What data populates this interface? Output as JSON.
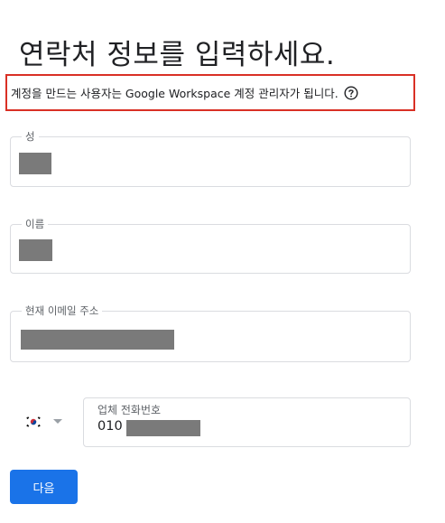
{
  "page": {
    "title": "연락처 정보를 입력하세요."
  },
  "notice": {
    "text": "계정을 만드는 사용자는 Google Workspace 계정 관리자가 됩니다.",
    "icon": "help-circle-icon",
    "border_color": "#d93025"
  },
  "fields": {
    "last_name": {
      "label": "성",
      "value": ""
    },
    "first_name": {
      "label": "이름",
      "value": ""
    },
    "email": {
      "label": "현재 이메일 주소",
      "value": ""
    }
  },
  "phone": {
    "country_flag": "south-korea-flag-icon",
    "label": "업체 전화번호",
    "value_prefix": "010"
  },
  "actions": {
    "next_label": "다음",
    "accent_color": "#1a73e8"
  }
}
